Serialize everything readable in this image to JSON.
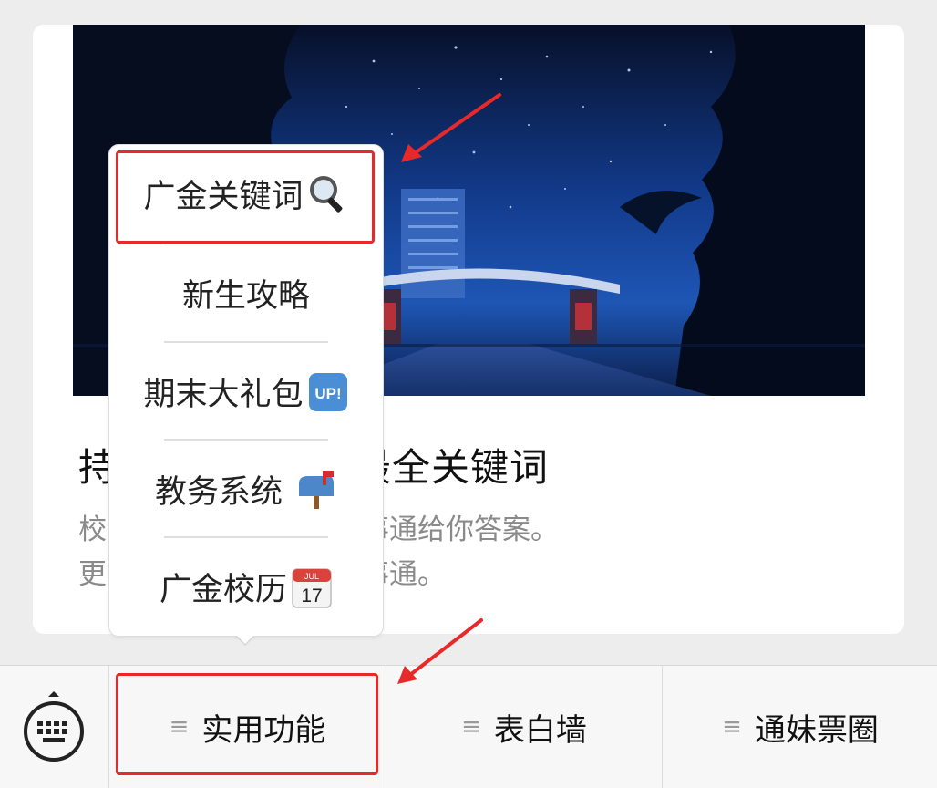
{
  "article": {
    "title": "持广金万事通，最全关键词",
    "desc_line1": "校园常见问题集合，万事通给你答案。",
    "desc_line2": "更多问题请咨询广金万事通。"
  },
  "popup_menu": {
    "items": [
      {
        "label": "广金关键词",
        "icon": "magnifier-icon",
        "glyph": "🔍"
      },
      {
        "label": "新生攻略"
      },
      {
        "label": "期末大礼包",
        "icon": "up-badge-icon",
        "glyph": "UP!"
      },
      {
        "label": "教务系统",
        "icon": "mailbox-icon",
        "glyph": "📫"
      },
      {
        "label": "广金校历",
        "icon": "calendar-icon",
        "glyph_month": "JUL",
        "glyph_day": "17"
      }
    ]
  },
  "bottom_bar": {
    "keyboard_icon": "keyboard-icon",
    "tabs": [
      {
        "label": "实用功能"
      },
      {
        "label": "表白墙"
      },
      {
        "label": "通妹票圈"
      }
    ],
    "menu_glyph": "≡"
  },
  "colors": {
    "highlight_red": "#e82929",
    "sky_dark": "#0a1636",
    "sky_light": "#1f4aa8"
  }
}
